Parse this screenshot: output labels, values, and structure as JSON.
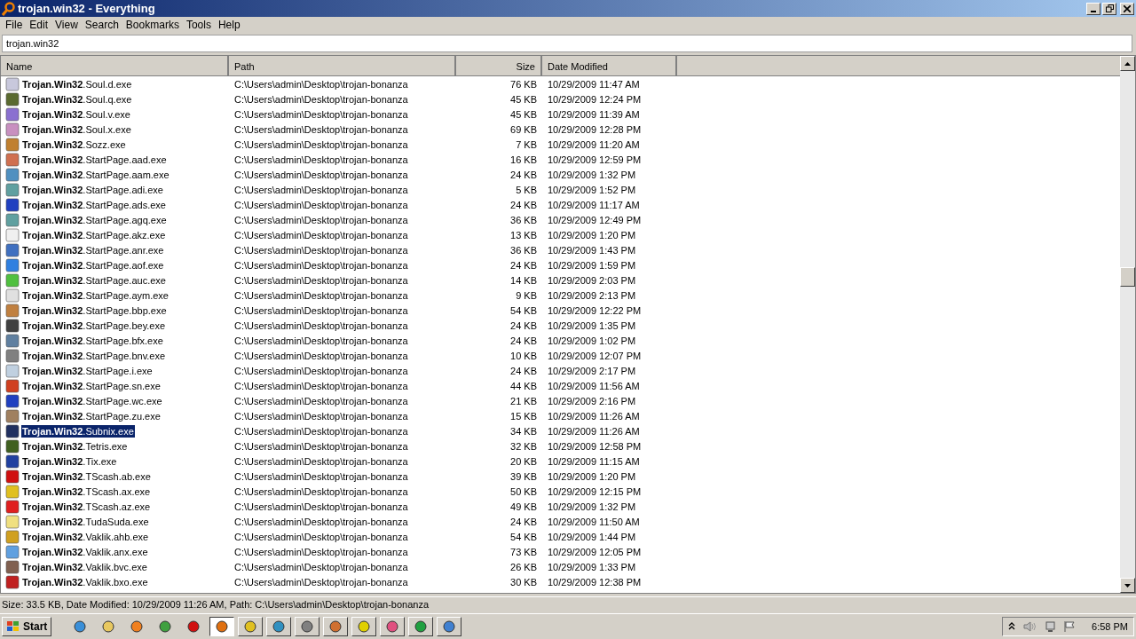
{
  "window": {
    "title": "trojan.win32 - Everything"
  },
  "menu": [
    "File",
    "Edit",
    "View",
    "Search",
    "Bookmarks",
    "Tools",
    "Help"
  ],
  "search": {
    "value": "trojan.win32"
  },
  "columns": [
    "Name",
    "Path",
    "Size",
    "Date Modified"
  ],
  "rows": [
    {
      "name": "**Trojan.Win32**.Soul.d.exe",
      "path": "C:\\Users\\admin\\Desktop\\trojan-bonanza",
      "size": "76 KB",
      "date": "10/29/2009 11:47 AM",
      "selected": false
    },
    {
      "name": "**Trojan.Win32**.Soul.q.exe",
      "path": "C:\\Users\\admin\\Desktop\\trojan-bonanza",
      "size": "45 KB",
      "date": "10/29/2009 12:24 PM",
      "selected": false
    },
    {
      "name": "**Trojan.Win32**.Soul.v.exe",
      "path": "C:\\Users\\admin\\Desktop\\trojan-bonanza",
      "size": "45 KB",
      "date": "10/29/2009 11:39 AM",
      "selected": false
    },
    {
      "name": "**Trojan.Win32**.Soul.x.exe",
      "path": "C:\\Users\\admin\\Desktop\\trojan-bonanza",
      "size": "69 KB",
      "date": "10/29/2009 12:28 PM",
      "selected": false
    },
    {
      "name": "**Trojan.Win32**.Sozz.exe",
      "path": "C:\\Users\\admin\\Desktop\\trojan-bonanza",
      "size": "7 KB",
      "date": "10/29/2009 11:20 AM",
      "selected": false
    },
    {
      "name": "**Trojan.Win32**.StartPage.aad.exe",
      "path": "C:\\Users\\admin\\Desktop\\trojan-bonanza",
      "size": "16 KB",
      "date": "10/29/2009 12:59 PM",
      "selected": false
    },
    {
      "name": "**Trojan.Win32**.StartPage.aam.exe",
      "path": "C:\\Users\\admin\\Desktop\\trojan-bonanza",
      "size": "24 KB",
      "date": "10/29/2009 1:32 PM",
      "selected": false
    },
    {
      "name": "**Trojan.Win32**.StartPage.adi.exe",
      "path": "C:\\Users\\admin\\Desktop\\trojan-bonanza",
      "size": "5 KB",
      "date": "10/29/2009 1:52 PM",
      "selected": false
    },
    {
      "name": "**Trojan.Win32**.StartPage.ads.exe",
      "path": "C:\\Users\\admin\\Desktop\\trojan-bonanza",
      "size": "24 KB",
      "date": "10/29/2009 11:17 AM",
      "selected": false
    },
    {
      "name": "**Trojan.Win32**.StartPage.agq.exe",
      "path": "C:\\Users\\admin\\Desktop\\trojan-bonanza",
      "size": "36 KB",
      "date": "10/29/2009 12:49 PM",
      "selected": false
    },
    {
      "name": "**Trojan.Win32**.StartPage.akz.exe",
      "path": "C:\\Users\\admin\\Desktop\\trojan-bonanza",
      "size": "13 KB",
      "date": "10/29/2009 1:20 PM",
      "selected": false
    },
    {
      "name": "**Trojan.Win32**.StartPage.anr.exe",
      "path": "C:\\Users\\admin\\Desktop\\trojan-bonanza",
      "size": "36 KB",
      "date": "10/29/2009 1:43 PM",
      "selected": false
    },
    {
      "name": "**Trojan.Win32**.StartPage.aof.exe",
      "path": "C:\\Users\\admin\\Desktop\\trojan-bonanza",
      "size": "24 KB",
      "date": "10/29/2009 1:59 PM",
      "selected": false
    },
    {
      "name": "**Trojan.Win32**.StartPage.auc.exe",
      "path": "C:\\Users\\admin\\Desktop\\trojan-bonanza",
      "size": "14 KB",
      "date": "10/29/2009 2:03 PM",
      "selected": false
    },
    {
      "name": "**Trojan.Win32**.StartPage.aym.exe",
      "path": "C:\\Users\\admin\\Desktop\\trojan-bonanza",
      "size": "9 KB",
      "date": "10/29/2009 2:13 PM",
      "selected": false
    },
    {
      "name": "**Trojan.Win32**.StartPage.bbp.exe",
      "path": "C:\\Users\\admin\\Desktop\\trojan-bonanza",
      "size": "54 KB",
      "date": "10/29/2009 12:22 PM",
      "selected": false
    },
    {
      "name": "**Trojan.Win32**.StartPage.bey.exe",
      "path": "C:\\Users\\admin\\Desktop\\trojan-bonanza",
      "size": "24 KB",
      "date": "10/29/2009 1:35 PM",
      "selected": false
    },
    {
      "name": "**Trojan.Win32**.StartPage.bfx.exe",
      "path": "C:\\Users\\admin\\Desktop\\trojan-bonanza",
      "size": "24 KB",
      "date": "10/29/2009 1:02 PM",
      "selected": false
    },
    {
      "name": "**Trojan.Win32**.StartPage.bnv.exe",
      "path": "C:\\Users\\admin\\Desktop\\trojan-bonanza",
      "size": "10 KB",
      "date": "10/29/2009 12:07 PM",
      "selected": false
    },
    {
      "name": "**Trojan.Win32**.StartPage.i.exe",
      "path": "C:\\Users\\admin\\Desktop\\trojan-bonanza",
      "size": "24 KB",
      "date": "10/29/2009 2:17 PM",
      "selected": false
    },
    {
      "name": "**Trojan.Win32**.StartPage.sn.exe",
      "path": "C:\\Users\\admin\\Desktop\\trojan-bonanza",
      "size": "44 KB",
      "date": "10/29/2009 11:56 AM",
      "selected": false
    },
    {
      "name": "**Trojan.Win32**.StartPage.wc.exe",
      "path": "C:\\Users\\admin\\Desktop\\trojan-bonanza",
      "size": "21 KB",
      "date": "10/29/2009 2:16 PM",
      "selected": false
    },
    {
      "name": "**Trojan.Win32**.StartPage.zu.exe",
      "path": "C:\\Users\\admin\\Desktop\\trojan-bonanza",
      "size": "15 KB",
      "date": "10/29/2009 11:26 AM",
      "selected": false
    },
    {
      "name": "**Trojan.Win32**.Subnix.exe",
      "path": "C:\\Users\\admin\\Desktop\\trojan-bonanza",
      "size": "34 KB",
      "date": "10/29/2009 11:26 AM",
      "selected": true
    },
    {
      "name": "**Trojan.Win32**.Tetris.exe",
      "path": "C:\\Users\\admin\\Desktop\\trojan-bonanza",
      "size": "32 KB",
      "date": "10/29/2009 12:58 PM",
      "selected": false
    },
    {
      "name": "**Trojan.Win32**.Tix.exe",
      "path": "C:\\Users\\admin\\Desktop\\trojan-bonanza",
      "size": "20 KB",
      "date": "10/29/2009 11:15 AM",
      "selected": false
    },
    {
      "name": "**Trojan.Win32**.TScash.ab.exe",
      "path": "C:\\Users\\admin\\Desktop\\trojan-bonanza",
      "size": "39 KB",
      "date": "10/29/2009 1:20 PM",
      "selected": false
    },
    {
      "name": "**Trojan.Win32**.TScash.ax.exe",
      "path": "C:\\Users\\admin\\Desktop\\trojan-bonanza",
      "size": "50 KB",
      "date": "10/29/2009 12:15 PM",
      "selected": false
    },
    {
      "name": "**Trojan.Win32**.TScash.az.exe",
      "path": "C:\\Users\\admin\\Desktop\\trojan-bonanza",
      "size": "49 KB",
      "date": "10/29/2009 1:32 PM",
      "selected": false
    },
    {
      "name": "**Trojan.Win32**.TudaSuda.exe",
      "path": "C:\\Users\\admin\\Desktop\\trojan-bonanza",
      "size": "24 KB",
      "date": "10/29/2009 11:50 AM",
      "selected": false
    },
    {
      "name": "**Trojan.Win32**.Vaklik.ahb.exe",
      "path": "C:\\Users\\admin\\Desktop\\trojan-bonanza",
      "size": "54 KB",
      "date": "10/29/2009 1:44 PM",
      "selected": false
    },
    {
      "name": "**Trojan.Win32**.Vaklik.anx.exe",
      "path": "C:\\Users\\admin\\Desktop\\trojan-bonanza",
      "size": "73 KB",
      "date": "10/29/2009 12:05 PM",
      "selected": false
    },
    {
      "name": "**Trojan.Win32**.Vaklik.bvc.exe",
      "path": "C:\\Users\\admin\\Desktop\\trojan-bonanza",
      "size": "26 KB",
      "date": "10/29/2009 1:33 PM",
      "selected": false
    },
    {
      "name": "**Trojan.Win32**.Vaklik.bxo.exe",
      "path": "C:\\Users\\admin\\Desktop\\trojan-bonanza",
      "size": "30 KB",
      "date": "10/29/2009 12:38 PM",
      "selected": false
    }
  ],
  "status_bar": "Size: 33.5 KB, Date Modified: 10/29/2009 11:26 AM, Path: C:\\Users\\admin\\Desktop\\trojan-bonanza",
  "taskbar": {
    "start": "Start",
    "buttons": [
      {
        "selected": false
      },
      {
        "selected": false
      },
      {
        "selected": false
      },
      {
        "selected": false
      },
      {
        "selected": false
      },
      {
        "selected": true
      },
      {
        "selected": false
      },
      {
        "selected": false
      },
      {
        "selected": false
      },
      {
        "selected": false
      },
      {
        "selected": false
      },
      {
        "selected": false
      },
      {
        "selected": false
      },
      {
        "selected": false
      }
    ],
    "clock": "6:58 PM"
  }
}
